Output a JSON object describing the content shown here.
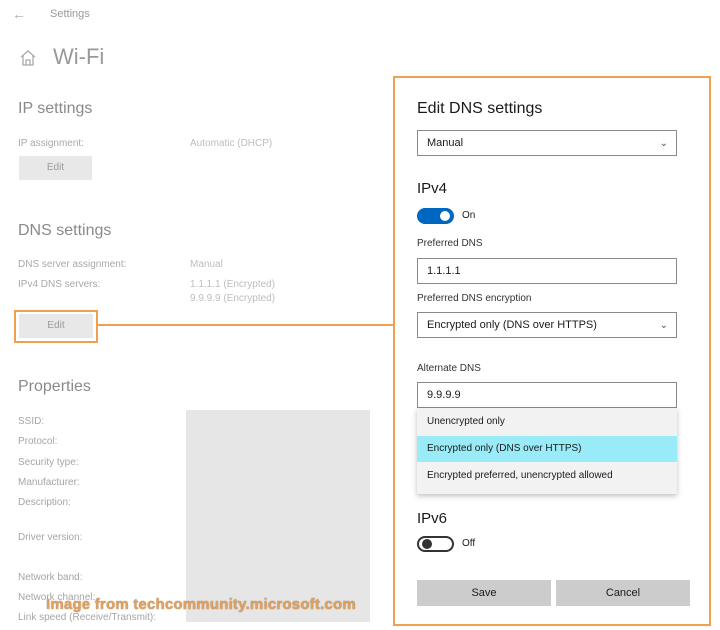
{
  "header": {
    "back_icon": "back-arrow-icon",
    "breadcrumb": "Settings",
    "home_icon": "home-icon",
    "title": "Wi-Fi"
  },
  "ip_settings": {
    "heading": "IP settings",
    "assignment_label": "IP assignment:",
    "assignment_value": "Automatic (DHCP)",
    "edit_label": "Edit"
  },
  "dns_settings": {
    "heading": "DNS settings",
    "assignment_label": "DNS server assignment:",
    "assignment_value": "Manual",
    "servers_label": "IPv4 DNS servers:",
    "server_1": "1.1.1.1 (Encrypted)",
    "server_2": "9.9.9.9 (Encrypted)",
    "edit_label": "Edit"
  },
  "properties": {
    "heading": "Properties",
    "labels": [
      "SSID:",
      "Protocol:",
      "Security type:",
      "Manufacturer:",
      "Description:",
      "Driver version:",
      "Network band:",
      "Network channel:",
      "Link speed (Receive/Transmit):"
    ]
  },
  "watermark": "Image from techcommunity.microsoft.com",
  "dialog": {
    "title": "Edit DNS settings",
    "mode_value": "Manual",
    "ipv4": {
      "heading": "IPv4",
      "toggle_state": "On",
      "preferred_label": "Preferred DNS",
      "preferred_value": "1.1.1.1",
      "encryption_label": "Preferred DNS encryption",
      "encryption_value": "Encrypted only (DNS over HTTPS)",
      "alternate_label": "Alternate DNS",
      "alternate_value": "9.9.9.9",
      "dropdown_options": [
        "Unencrypted only",
        "Encrypted only (DNS over HTTPS)",
        "Encrypted preferred, unencrypted allowed"
      ],
      "selected_option": "Encrypted only (DNS over HTTPS)"
    },
    "ipv6": {
      "heading": "IPv6",
      "toggle_state": "Off"
    },
    "save_label": "Save",
    "cancel_label": "Cancel"
  },
  "colors": {
    "accent": "#0067c0",
    "highlight_border": "#f0a050",
    "selected_option": "#99ebf8",
    "button_bg": "#cccccc"
  }
}
